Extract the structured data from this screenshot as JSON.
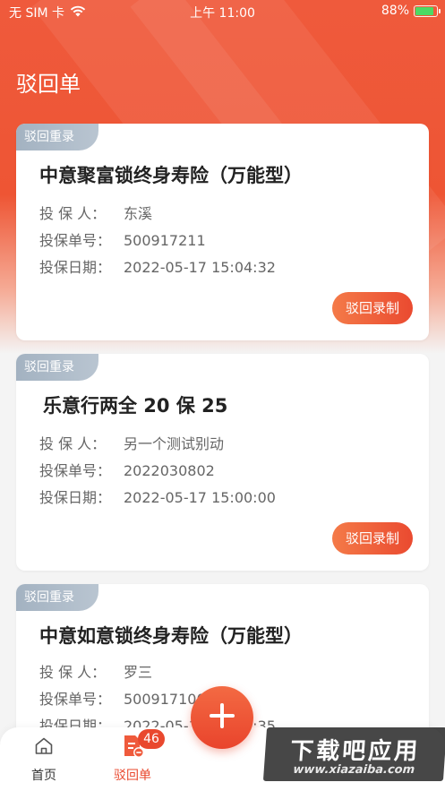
{
  "status_bar": {
    "carrier": "无 SIM 卡",
    "time": "上午 11:00",
    "battery": "88%",
    "battery_level": 0.88
  },
  "page": {
    "title": "驳回单"
  },
  "cards": [
    {
      "tag": "驳回重录",
      "title": "中意聚富锁终身寿险（万能型）",
      "insured_label": "投 保 人：",
      "insured": "东溪",
      "policy_no_label": "投保单号：",
      "policy_no": "500917211",
      "date_label": "投保日期：",
      "date": "2022-05-17 15:04:32",
      "button": "驳回录制"
    },
    {
      "tag": "驳回重录",
      "title": "乐意行两全 20 保 25",
      "insured_label": "投 保 人：",
      "insured": "另一个测试别动",
      "policy_no_label": "投保单号：",
      "policy_no": "2022030802",
      "date_label": "投保日期：",
      "date": "2022-05-17 15:00:00",
      "button": "驳回录制"
    },
    {
      "tag": "驳回重录",
      "title": "中意如意锁终身寿险（万能型）",
      "insured_label": "投 保 人：",
      "insured": "罗三",
      "policy_no_label": "投保单号：",
      "policy_no": "500917100",
      "date_label": "投保日期：",
      "date": "2022-05-17 15:19:35"
    }
  ],
  "tabbar": {
    "home": {
      "label": "首页",
      "icon": "home-icon"
    },
    "rejected": {
      "label": "驳回单",
      "icon": "document-icon",
      "badge": "46"
    }
  },
  "fab": {
    "icon": "plus-icon"
  },
  "watermark": {
    "line1": "下载吧应用",
    "line2": "www.xiazaiba.com"
  },
  "colors": {
    "accent": "#ea4a30",
    "tag": "#a3b2c1"
  }
}
